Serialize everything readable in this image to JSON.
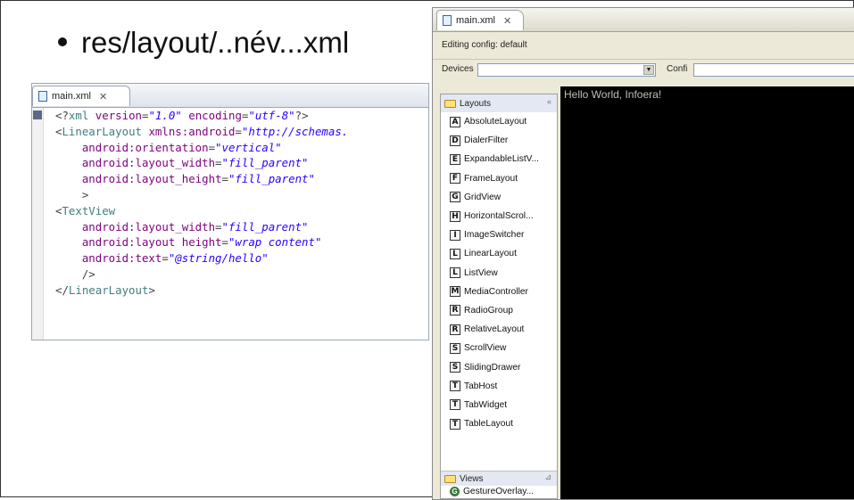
{
  "slide": {
    "bullet": "res/layout/..név...xml"
  },
  "xml_editor": {
    "tab_label": "main.xml",
    "close_glyph": "✕",
    "lines": [
      {
        "parts": [
          [
            "pun",
            "<?"
          ],
          [
            "kw",
            "xml"
          ],
          [
            "attr",
            " version"
          ],
          [
            "pun",
            "="
          ],
          [
            "val",
            "\"1.0\""
          ],
          [
            "attr",
            " encoding"
          ],
          [
            "pun",
            "="
          ],
          [
            "val",
            "\"utf-8\""
          ],
          [
            "pun",
            "?>"
          ]
        ]
      },
      {
        "parts": [
          [
            "pun",
            "<"
          ],
          [
            "kw",
            "LinearLayout"
          ],
          [
            "attr",
            " xmlns:android"
          ],
          [
            "pun",
            "="
          ],
          [
            "val",
            "\"http://schemas."
          ]
        ]
      },
      {
        "parts": [
          [
            "attr",
            "    android:orientation"
          ],
          [
            "pun",
            "="
          ],
          [
            "val",
            "\"vertical\""
          ]
        ]
      },
      {
        "parts": [
          [
            "attr",
            "    android:layout_width"
          ],
          [
            "pun",
            "="
          ],
          [
            "val",
            "\"fill_parent\""
          ]
        ]
      },
      {
        "parts": [
          [
            "attr",
            "    android:layout_height"
          ],
          [
            "pun",
            "="
          ],
          [
            "val",
            "\"fill_parent\""
          ]
        ]
      },
      {
        "parts": [
          [
            "pun",
            "    >"
          ]
        ]
      },
      {
        "parts": [
          [
            "pun",
            "<"
          ],
          [
            "kw",
            "TextView"
          ]
        ]
      },
      {
        "parts": [
          [
            "attr",
            "    android:layout_width"
          ],
          [
            "pun",
            "="
          ],
          [
            "val",
            "\"fill_parent\""
          ]
        ]
      },
      {
        "parts": [
          [
            "attr",
            "    android:layout height"
          ],
          [
            "pun",
            "="
          ],
          [
            "val",
            "\"wrap content\""
          ]
        ]
      },
      {
        "parts": [
          [
            "attr",
            "    android:text"
          ],
          [
            "pun",
            "="
          ],
          [
            "val",
            "\"@string/hello\""
          ]
        ]
      },
      {
        "parts": [
          [
            "pun",
            "    />"
          ]
        ]
      },
      {
        "parts": [
          [
            "pun",
            "</"
          ],
          [
            "kw",
            "LinearLayout"
          ],
          [
            "pun",
            ">"
          ]
        ]
      }
    ]
  },
  "layout_editor": {
    "tab_label": "main.xml",
    "close_glyph": "✕",
    "config_label": "Editing config: default",
    "devices_label": "Devices",
    "config_short": "Confi",
    "dropdown_arrow": "▼",
    "palette": {
      "layouts_header": "Layouts",
      "collapse_glyph": "«",
      "items": [
        {
          "letter": "A",
          "label": "AbsoluteLayout"
        },
        {
          "letter": "D",
          "label": "DialerFilter"
        },
        {
          "letter": "E",
          "label": "ExpandableListV..."
        },
        {
          "letter": "F",
          "label": "FrameLayout"
        },
        {
          "letter": "G",
          "label": "GridView"
        },
        {
          "letter": "H",
          "label": "HorizontalScrol..."
        },
        {
          "letter": "I",
          "label": "ImageSwitcher"
        },
        {
          "letter": "L",
          "label": "LinearLayout"
        },
        {
          "letter": "L",
          "label": "ListView"
        },
        {
          "letter": "M",
          "label": "MediaController"
        },
        {
          "letter": "R",
          "label": "RadioGroup"
        },
        {
          "letter": "R",
          "label": "RelativeLayout"
        },
        {
          "letter": "S",
          "label": "ScrollView"
        },
        {
          "letter": "S",
          "label": "SlidingDrawer"
        },
        {
          "letter": "T",
          "label": "TabHost"
        },
        {
          "letter": "T",
          "label": "TabWidget"
        },
        {
          "letter": "T",
          "label": "TableLayout"
        }
      ],
      "views_header": "Views",
      "pin_glyph": "⊿",
      "views_item": "GestureOverlay..."
    },
    "preview_text": "Hello World, Infoera!"
  }
}
